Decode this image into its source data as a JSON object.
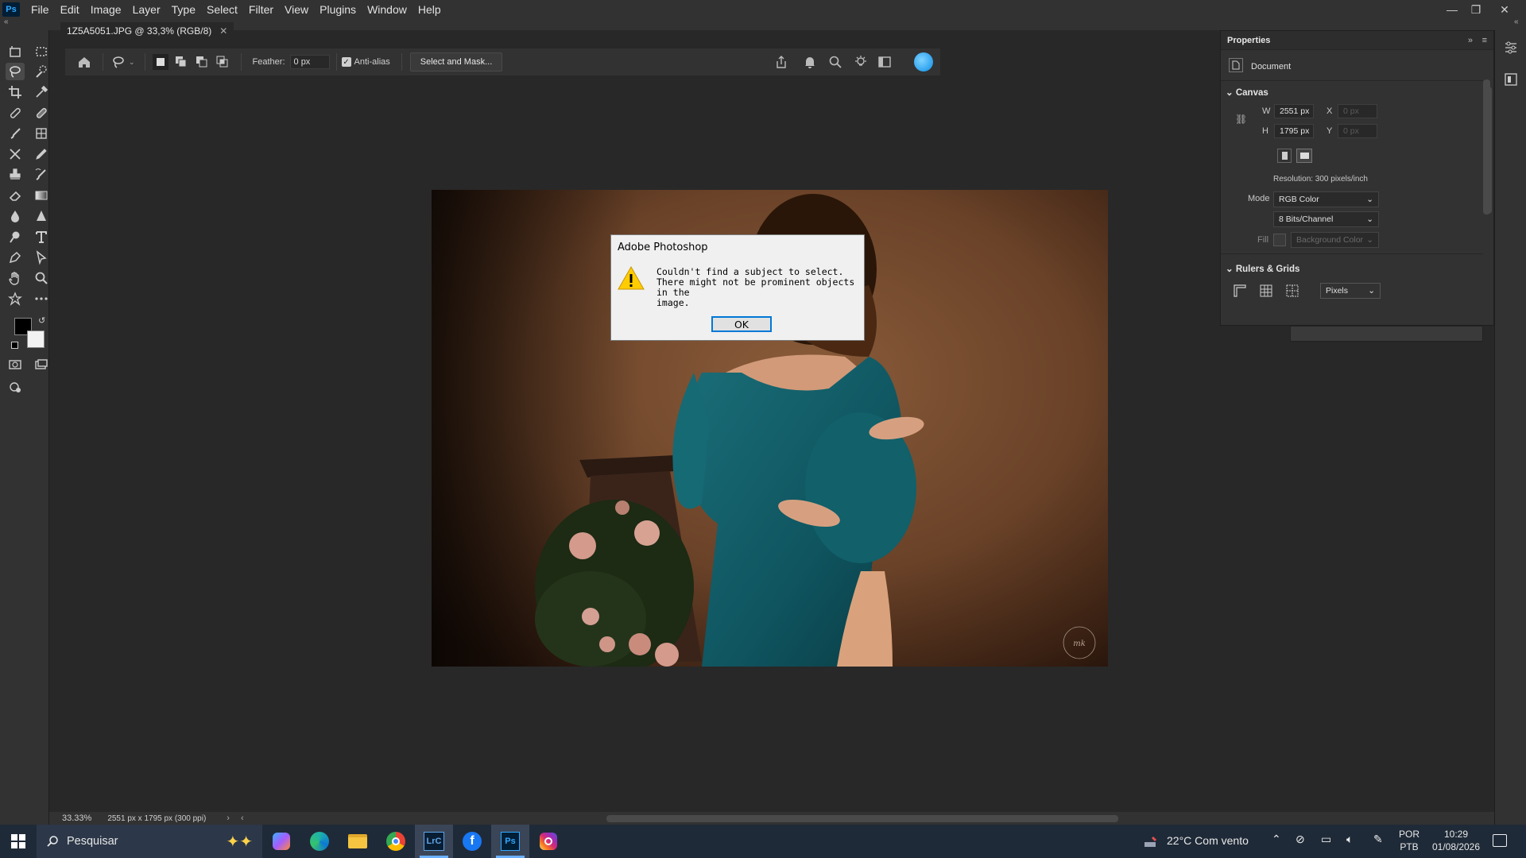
{
  "app": {
    "logo": "Ps",
    "menus": [
      "File",
      "Edit",
      "Image",
      "Layer",
      "Type",
      "Select",
      "Filter",
      "View",
      "Plugins",
      "Window",
      "Help"
    ]
  },
  "document": {
    "tab_title": "1Z5A5051.JPG @ 33,3% (RGB/8)"
  },
  "options_bar": {
    "feather_label": "Feather:",
    "feather_value": "0 px",
    "antialias_label": "Anti-alias",
    "antialias_checked": true,
    "select_mask_label": "Select and Mask..."
  },
  "dialog": {
    "title": "Adobe Photoshop",
    "message_line1": "Couldn't find a subject to select.",
    "message_line2": "There might not be prominent objects in the",
    "message_line3": "image.",
    "ok_label": "OK"
  },
  "properties": {
    "title": "Properties",
    "document_label": "Document",
    "canvas_section": "Canvas",
    "w_label": "W",
    "w_value": "2551 px",
    "h_label": "H",
    "h_value": "1795 px",
    "x_label": "X",
    "x_value": "0 px",
    "y_label": "Y",
    "y_value": "0 px",
    "resolution": "Resolution: 300 pixels/inch",
    "mode_label": "Mode",
    "mode_value": "RGB Color",
    "bits_value": "8 Bits/Channel",
    "fill_label": "Fill",
    "fill_value": "Background Color",
    "rulers_section": "Rulers & Grids",
    "units_value": "Pixels"
  },
  "status": {
    "zoom": "33.33%",
    "doc_info": "2551 px x 1795 px (300 ppi)"
  },
  "taskbar": {
    "search_placeholder": "Pesquisar",
    "weather": "22°C  Com vento",
    "lang1": "POR",
    "lang2": "PTB",
    "time": "10:29",
    "date": "01/08/2026",
    "apps": [
      "copilot-icon",
      "edge-icon",
      "file-explorer-icon",
      "chrome-icon",
      "lightroom-classic-icon",
      "facebook-icon",
      "photoshop-icon",
      "instagram-icon"
    ]
  },
  "colors": {
    "accent": "#31a8ff",
    "dialog_focus": "#0078d7",
    "taskbar": "#1f2a38"
  }
}
